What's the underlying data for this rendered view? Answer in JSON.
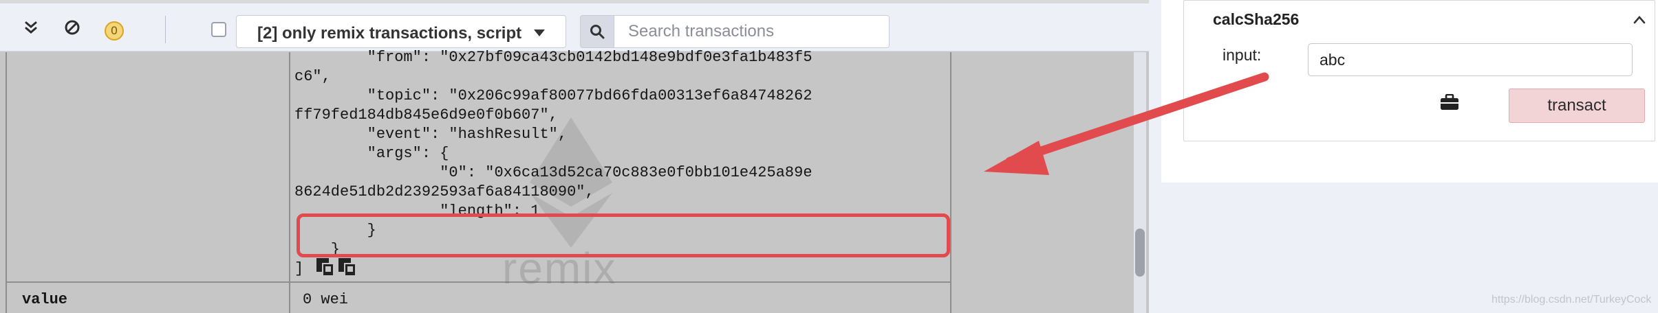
{
  "toolbar": {
    "pending_count": "0",
    "filter_label": "[2] only remix transactions, script",
    "search_placeholder": "Search transactions"
  },
  "log": {
    "lines": [
      "        \"from\": \"0x27bf09ca43cb0142bd148e9bdf0e3fa1b483f5",
      "c6\",",
      "        \"topic\": \"0x206c99af80077bd66fda00313ef6a84748262",
      "ff79fed184db845e6d9e0f0b607\",",
      "        \"event\": \"hashResult\",",
      "        \"args\": {",
      "                \"0\": \"0x6ca13d52ca70c883e0f0bb101e425a89e",
      "8624de51db2d2392593af6a84118090\",",
      "                \"length\": 1",
      "        }",
      "    }",
      "]"
    ],
    "row_key": "value",
    "row_value": "0 wei",
    "watermark": "remix"
  },
  "function_panel": {
    "title": "calcSha256",
    "input_label": "input:",
    "input_value": "abc",
    "transact_label": "transact"
  },
  "credit": "https://blog.csdn.net/TurkeyCock",
  "colors": {
    "highlight": "#e24b4e",
    "transact_bg": "#f3d4d6"
  }
}
